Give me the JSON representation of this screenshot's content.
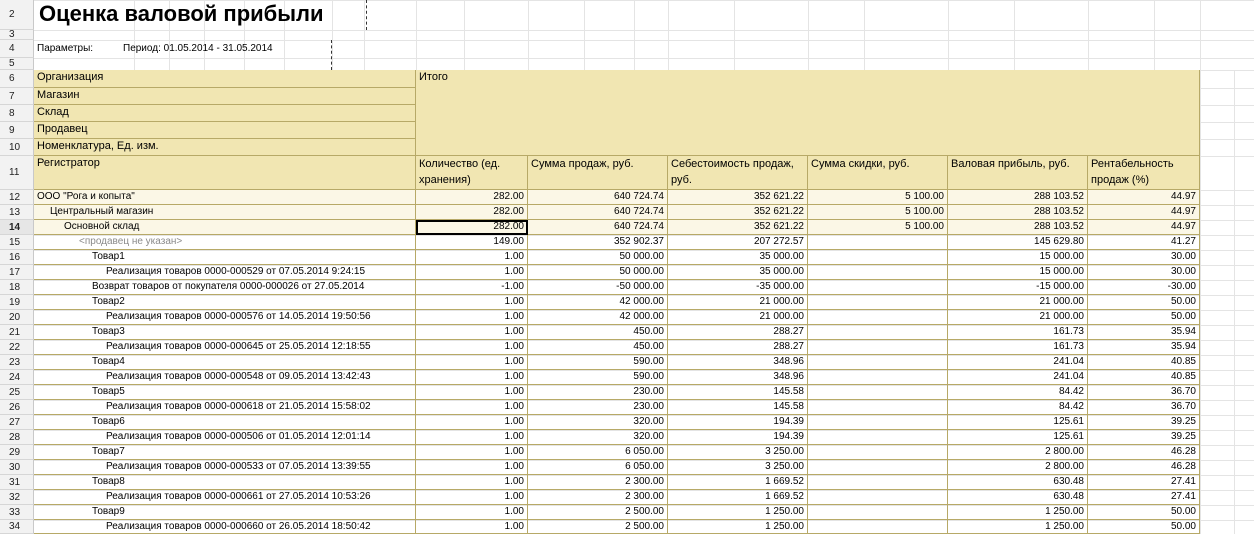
{
  "report": {
    "title": "Оценка валовой прибыли",
    "params_label": "Параметры:",
    "period": "Период: 01.05.2014 - 31.05.2014"
  },
  "row_numbers": [
    "2",
    "3",
    "4",
    "5",
    "6",
    "7",
    "8",
    "9",
    "10",
    "11",
    "12",
    "13",
    "14",
    "15",
    "16",
    "17",
    "18",
    "19",
    "20",
    "21",
    "22",
    "23",
    "24",
    "25",
    "26",
    "27",
    "28",
    "29",
    "30",
    "31",
    "32",
    "33",
    "34"
  ],
  "header": {
    "group_labels": [
      "Организация",
      "Магазин",
      "Склад",
      "Продавец",
      "Номенклатура, Ед. изм."
    ],
    "total_label": "Итого",
    "registrar_label": "Регистратор",
    "columns": [
      "Количество (ед. хранения)",
      "Сумма продаж, руб.",
      "Себестоимость продаж, руб.",
      "Сумма скидки, руб.",
      "Валовая прибыль, руб.",
      "Рентабельность продаж (%)"
    ]
  },
  "rows": [
    {
      "label": "ООО \"Рога и копыта\"",
      "level": 0,
      "style": "grp",
      "values": [
        "282.00",
        "640 724.74",
        "352 621.22",
        "5 100.00",
        "288 103.52",
        "44.97"
      ]
    },
    {
      "label": "Центральный магазин",
      "level": 1,
      "style": "grp",
      "values": [
        "282.00",
        "640 724.74",
        "352 621.22",
        "5 100.00",
        "288 103.52",
        "44.97"
      ]
    },
    {
      "label": "Основной склад",
      "level": 2,
      "style": "grp",
      "values": [
        "282.00",
        "640 724.74",
        "352 621.22",
        "5 100.00",
        "288 103.52",
        "44.97"
      ]
    },
    {
      "label": "<продавец не указан>",
      "level": 3,
      "style": "grey",
      "values": [
        "149.00",
        "352 902.37",
        "207 272.57",
        "",
        "145 629.80",
        "41.27"
      ]
    },
    {
      "label": "Товар1",
      "level": 4,
      "style": "",
      "values": [
        "1.00",
        "50 000.00",
        "35 000.00",
        "",
        "15 000.00",
        "30.00"
      ]
    },
    {
      "label": "Реализация товаров 0000-000529 от 07.05.2014 9:24:15",
      "level": 5,
      "style": "",
      "values": [
        "1.00",
        "50 000.00",
        "35 000.00",
        "",
        "15 000.00",
        "30.00"
      ]
    },
    {
      "label": "Возврат товаров от покупателя 0000-000026 от 27.05.2014",
      "level": 4,
      "style": "",
      "values": [
        "-1.00",
        "-50 000.00",
        "-35 000.00",
        "",
        "-15 000.00",
        "-30.00"
      ]
    },
    {
      "label": "Товар2",
      "level": 4,
      "style": "",
      "values": [
        "1.00",
        "42 000.00",
        "21 000.00",
        "",
        "21 000.00",
        "50.00"
      ]
    },
    {
      "label": "Реализация товаров 0000-000576 от 14.05.2014 19:50:56",
      "level": 5,
      "style": "",
      "values": [
        "1.00",
        "42 000.00",
        "21 000.00",
        "",
        "21 000.00",
        "50.00"
      ]
    },
    {
      "label": "Товар3",
      "level": 4,
      "style": "",
      "values": [
        "1.00",
        "450.00",
        "288.27",
        "",
        "161.73",
        "35.94"
      ]
    },
    {
      "label": "Реализация товаров 0000-000645 от 25.05.2014 12:18:55",
      "level": 5,
      "style": "",
      "values": [
        "1.00",
        "450.00",
        "288.27",
        "",
        "161.73",
        "35.94"
      ]
    },
    {
      "label": "Товар4",
      "level": 4,
      "style": "",
      "values": [
        "1.00",
        "590.00",
        "348.96",
        "",
        "241.04",
        "40.85"
      ]
    },
    {
      "label": "Реализация товаров 0000-000548 от 09.05.2014 13:42:43",
      "level": 5,
      "style": "",
      "values": [
        "1.00",
        "590.00",
        "348.96",
        "",
        "241.04",
        "40.85"
      ]
    },
    {
      "label": "Товар5",
      "level": 4,
      "style": "",
      "values": [
        "1.00",
        "230.00",
        "145.58",
        "",
        "84.42",
        "36.70"
      ]
    },
    {
      "label": "Реализация товаров 0000-000618 от 21.05.2014 15:58:02",
      "level": 5,
      "style": "",
      "values": [
        "1.00",
        "230.00",
        "145.58",
        "",
        "84.42",
        "36.70"
      ]
    },
    {
      "label": "Товар6",
      "level": 4,
      "style": "",
      "values": [
        "1.00",
        "320.00",
        "194.39",
        "",
        "125.61",
        "39.25"
      ]
    },
    {
      "label": "Реализация товаров 0000-000506 от 01.05.2014 12:01:14",
      "level": 5,
      "style": "",
      "values": [
        "1.00",
        "320.00",
        "194.39",
        "",
        "125.61",
        "39.25"
      ]
    },
    {
      "label": "Товар7",
      "level": 4,
      "style": "",
      "values": [
        "1.00",
        "6 050.00",
        "3 250.00",
        "",
        "2 800.00",
        "46.28"
      ]
    },
    {
      "label": "Реализация товаров 0000-000533 от 07.05.2014 13:39:55",
      "level": 5,
      "style": "",
      "values": [
        "1.00",
        "6 050.00",
        "3 250.00",
        "",
        "2 800.00",
        "46.28"
      ]
    },
    {
      "label": "Товар8",
      "level": 4,
      "style": "",
      "values": [
        "1.00",
        "2 300.00",
        "1 669.52",
        "",
        "630.48",
        "27.41"
      ]
    },
    {
      "label": "Реализация товаров 0000-000661 от 27.05.2014 10:53:26",
      "level": 5,
      "style": "",
      "values": [
        "1.00",
        "2 300.00",
        "1 669.52",
        "",
        "630.48",
        "27.41"
      ]
    },
    {
      "label": "Товар9",
      "level": 4,
      "style": "",
      "values": [
        "1.00",
        "2 500.00",
        "1 250.00",
        "",
        "1 250.00",
        "50.00"
      ]
    },
    {
      "label": "Реализация товаров 0000-000660 от 26.05.2014 18:50:42",
      "level": 5,
      "style": "",
      "values": [
        "1.00",
        "2 500.00",
        "1 250.00",
        "",
        "1 250.00",
        "50.00"
      ]
    }
  ]
}
